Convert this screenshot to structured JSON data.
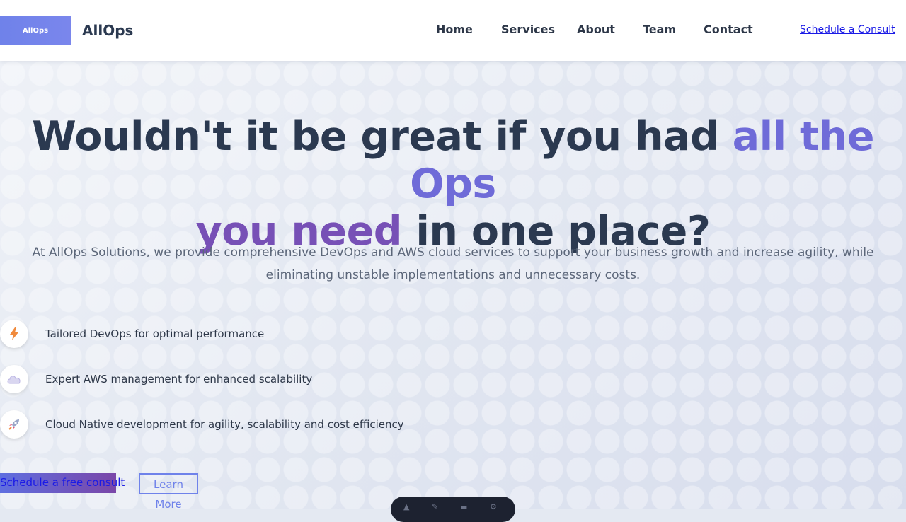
{
  "header": {
    "logo_text": "AllOps",
    "brand": "AllOps",
    "nav": [
      {
        "label": "Home"
      },
      {
        "label": "Services"
      },
      {
        "label": "About"
      },
      {
        "label": "Team"
      },
      {
        "label": "Contact"
      }
    ],
    "cta_label": "Schedule a Consult"
  },
  "hero": {
    "headline_part1": "Wouldn't it be great if you had ",
    "headline_highlight1": "all the Ops",
    "headline_highlight2": "you need",
    "headline_part2": " in one place?",
    "subtext": "At AllOps Solutions, we provide comprehensive DevOps and AWS cloud services to support your business growth and increase agility, while eliminating unstable implementations and unnecessary costs.",
    "features": [
      {
        "icon": "lightning-icon",
        "text": "Tailored DevOps for optimal performance"
      },
      {
        "icon": "cloud-icon",
        "text": "Expert AWS management for enhanced scalability"
      },
      {
        "icon": "rocket-icon",
        "text": "Cloud Native development for agility, scalability and cost efficiency"
      }
    ],
    "primary_cta": "Schedule a free consult",
    "secondary_cta": "Learn More"
  },
  "colors": {
    "accent_blue": "#6f82ea",
    "accent_purple": "#7750b6",
    "text_dark": "#2b3950",
    "link": "#1a1ae6"
  }
}
